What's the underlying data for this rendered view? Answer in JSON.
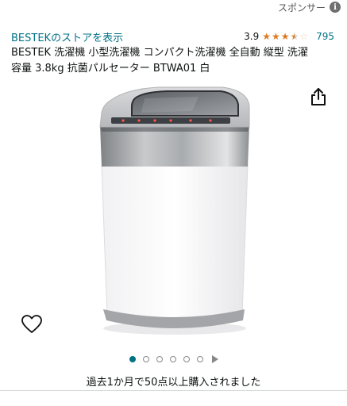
{
  "sponsor": {
    "label": "スポンサー",
    "info_icon": "info-icon"
  },
  "store": {
    "link_text": "BESTEKのストアを表示"
  },
  "rating": {
    "value": "3.9",
    "stars": 3.9,
    "count": "795"
  },
  "product": {
    "title": "BESTEK 洗濯機 小型洗濯機 コンパクト洗濯機 全自動 縦型 洗濯容量 3.8kg 抗菌パルセーター BTWA01 白"
  },
  "icons": {
    "share": "share-icon",
    "heart": "heart-icon"
  },
  "carousel": {
    "dot_count": 6,
    "active_index": 0,
    "next_icon": "play-icon"
  },
  "purchase_note": "過去1か月で50点以上購入されました",
  "colors": {
    "link": "#007185",
    "star": "#de7921"
  }
}
